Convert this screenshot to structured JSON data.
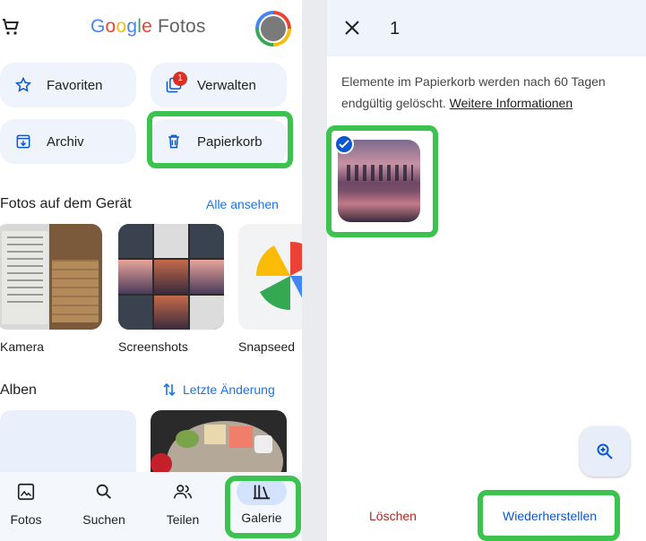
{
  "header": {
    "logo_google": "Google",
    "logo_product": "Fotos",
    "logo_colors": [
      "#4285f4",
      "#ea4335",
      "#fbbc05",
      "#4285f4",
      "#34a853",
      "#ea4335"
    ]
  },
  "quick_actions": {
    "favoriten": "Favoriten",
    "verwalten": "Verwalten",
    "verwalten_badge": "1",
    "archiv": "Archiv",
    "papierkorb": "Papierkorb"
  },
  "device_section": {
    "title": "Fotos auf dem Gerät",
    "link": "Alle ansehen",
    "folders": [
      "Kamera",
      "Screenshots",
      "Snapseed"
    ]
  },
  "albums_section": {
    "title": "Alben",
    "link": "Letzte Änderung"
  },
  "bottom_nav": [
    "Fotos",
    "Suchen",
    "Teilen",
    "Galerie"
  ],
  "trash": {
    "selected_count": "1",
    "info": "Elemente im Papierkorb werden nach 60 Tagen endgültig gelöscht.",
    "more_link": "Weitere Informationen",
    "delete_label": "Löschen",
    "restore_label": "Wiederherstellen"
  },
  "colors": {
    "accent": "#1a73e8",
    "highlight": "#3cc24f",
    "delete": "#b3261e",
    "chip_bg": "#eef3fc"
  }
}
